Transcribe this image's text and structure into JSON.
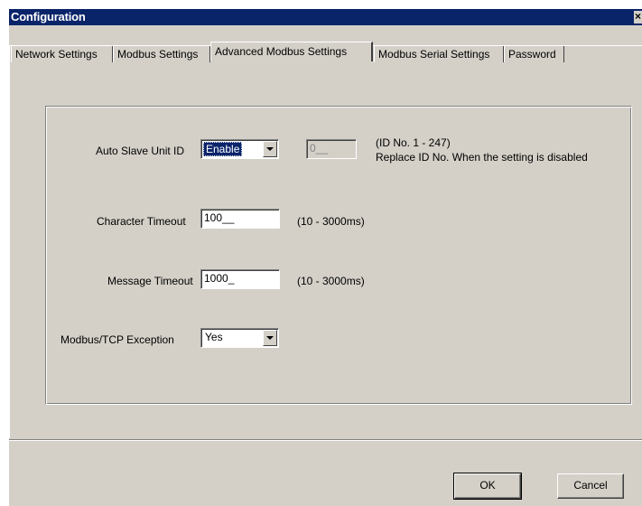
{
  "window": {
    "title": "Configuration",
    "close_glyph": "×"
  },
  "tabs": [
    {
      "label": "Network Settings",
      "active": false
    },
    {
      "label": "Modbus Settings",
      "active": false
    },
    {
      "label": "Advanced Modbus Settings",
      "active": true
    },
    {
      "label": "Modbus Serial Settings",
      "active": false
    },
    {
      "label": "Password",
      "active": false
    }
  ],
  "settings": {
    "auto_slave_unit_id": {
      "label": "Auto Slave Unit ID",
      "value": "Enable",
      "id_field_value": "0__",
      "hint_line1": "(ID No. 1 - 247)",
      "hint_line2": "Replace ID No. When the setting is disabled"
    },
    "character_timeout": {
      "label": "Character Timeout",
      "value": "100__",
      "range": "(10 - 3000ms)"
    },
    "message_timeout": {
      "label": "Message Timeout",
      "value": "1000_",
      "range": "(10 - 3000ms)"
    },
    "modbus_tcp_exception": {
      "label": "Modbus/TCP Exception",
      "value": "Yes"
    }
  },
  "buttons": {
    "ok": "OK",
    "cancel": "Cancel"
  }
}
